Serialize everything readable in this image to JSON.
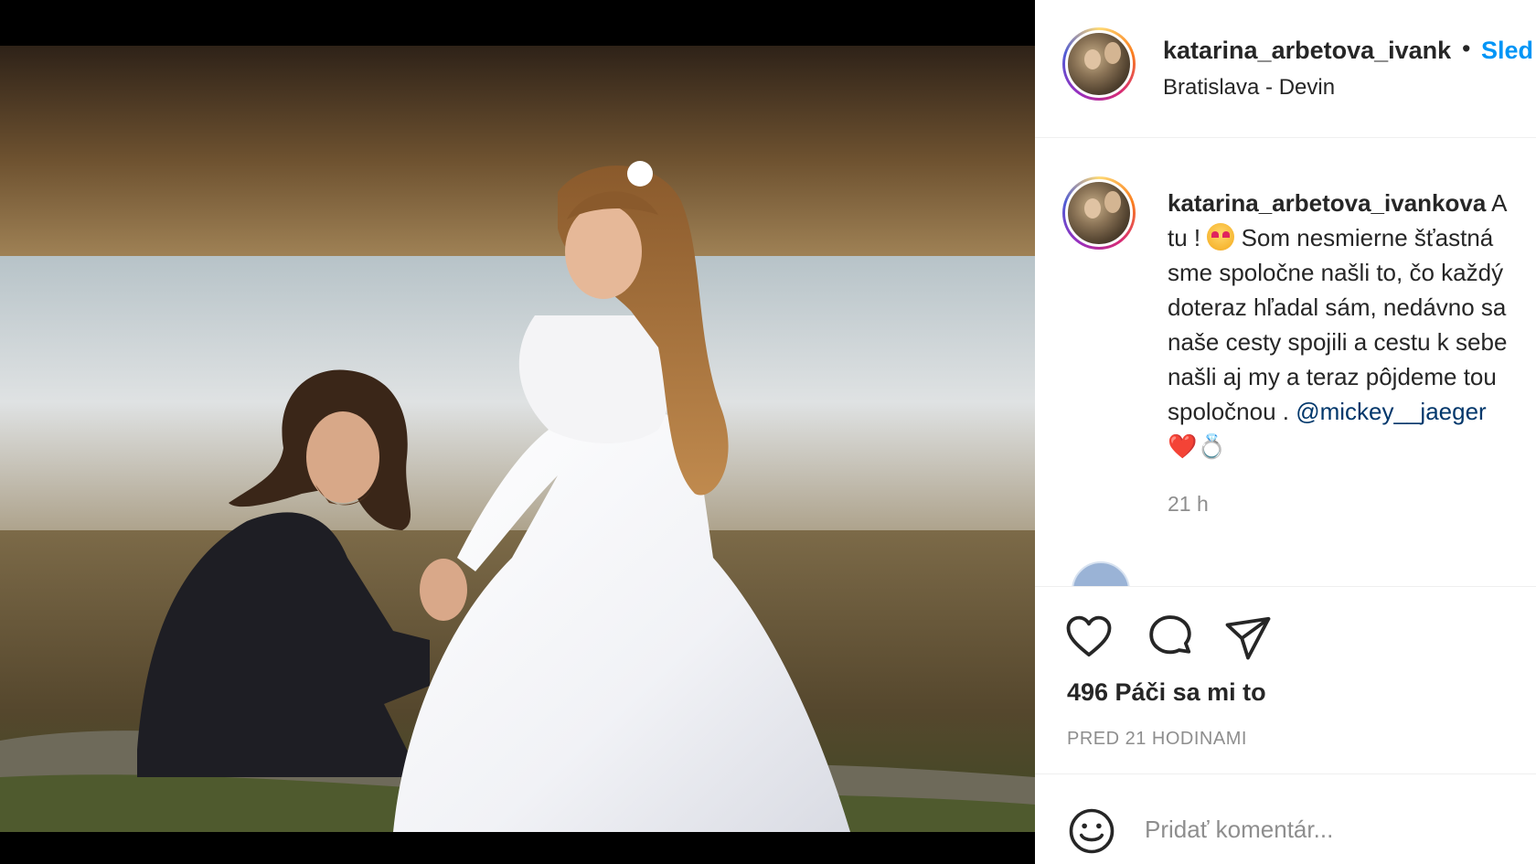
{
  "post": {
    "username": "katarina_arbetova_ivankova",
    "header_username_visible": "katarina_arbetova_ivank",
    "separator": "•",
    "follow_label": "Sled",
    "location": "Bratislava - Devin"
  },
  "caption": {
    "username": "katarina_arbetova_ivankova",
    "line1_rest": " A",
    "line2_start": "tu ! ",
    "line2_end": " Som nesmierne šťastná",
    "line3": "sme spoločne našli to, čo každý",
    "line4": "doteraz hľadal sám, nedávno sa",
    "line5": "naše cesty spojili a cestu k sebe",
    "line6": "našli aj my a teraz pôjdeme tou",
    "line7_start": "spoločnou . ",
    "mention": "@mickey__jaeger",
    "line8": "❤️💍",
    "time": "21 h"
  },
  "actions": {
    "like_icon": "heart-icon",
    "comment_icon": "speech-bubble-icon",
    "share_icon": "paper-plane-icon",
    "likes_text": "496 Páči sa mi to",
    "timestamp": "PRED 21 HODINAMI"
  },
  "add_comment": {
    "emoji_icon": "smiley-icon",
    "placeholder": "Pridať komentár..."
  },
  "colors": {
    "link_blue": "#0095f6",
    "mention_blue": "#00376b",
    "secondary_text": "#8e8e8e",
    "border": "#efefef"
  }
}
